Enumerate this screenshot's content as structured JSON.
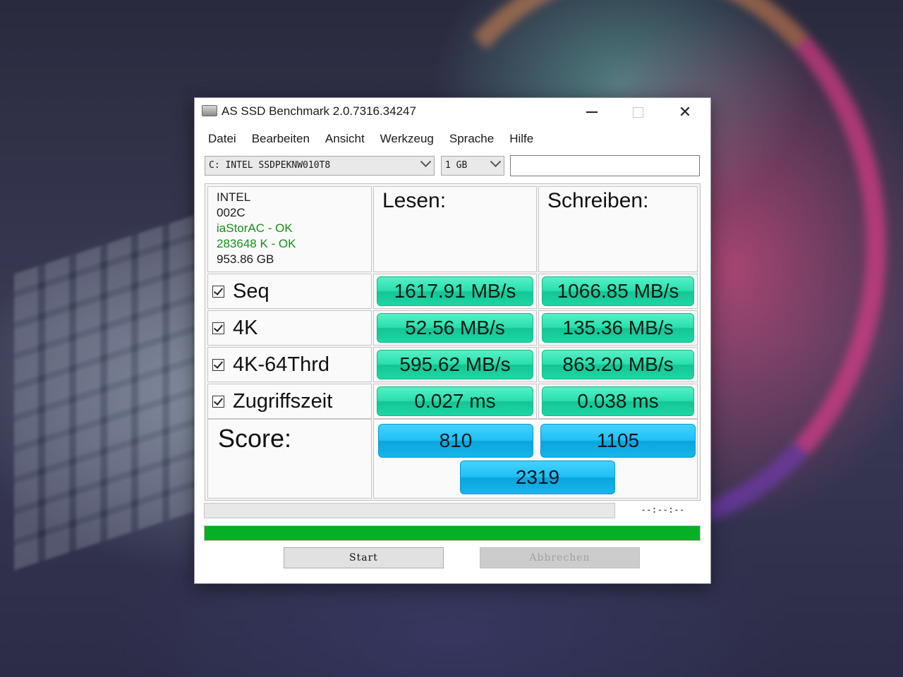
{
  "window": {
    "title": "AS SSD Benchmark 2.0.7316.34247",
    "controls": {
      "minimize": "minimize-icon",
      "maximize": "maximize-icon",
      "close": "close-icon"
    }
  },
  "menu": [
    "Datei",
    "Bearbeiten",
    "Ansicht",
    "Werkzeug",
    "Sprache",
    "Hilfe"
  ],
  "toolbar": {
    "drive": "C: INTEL SSDPEKNW010T8",
    "size": "1 GB",
    "text_value": ""
  },
  "drive_info": {
    "vendor": "INTEL",
    "firmware": "002C",
    "driver_status": "iaStorAC - OK",
    "alignment_status": "283648 K - OK",
    "capacity": "953.86 GB"
  },
  "headers": {
    "read": "Lesen:",
    "write": "Schreiben:"
  },
  "tests": [
    {
      "label": "Seq",
      "checked": true,
      "read": "1617.91 MB/s",
      "write": "1066.85 MB/s"
    },
    {
      "label": "4K",
      "checked": true,
      "read": "52.56 MB/s",
      "write": "135.36 MB/s"
    },
    {
      "label": "4K-64Thrd",
      "checked": true,
      "read": "595.62 MB/s",
      "write": "863.20 MB/s"
    },
    {
      "label": "Zugriffszeit",
      "checked": true,
      "read": "0.027 ms",
      "write": "0.038 ms"
    }
  ],
  "score": {
    "label": "Score:",
    "read": "810",
    "write": "1105",
    "total": "2319"
  },
  "progress": {
    "time": "--:--:--",
    "test_progress": 0,
    "overall_progress": 1.0
  },
  "buttons": {
    "start": "Start",
    "abort": "Abbrechen"
  },
  "colors": {
    "result_green": "#27e0ad",
    "score_blue": "#1fc0f6",
    "progress_green": "#06b025",
    "ok_text": "#1a8c1a"
  }
}
